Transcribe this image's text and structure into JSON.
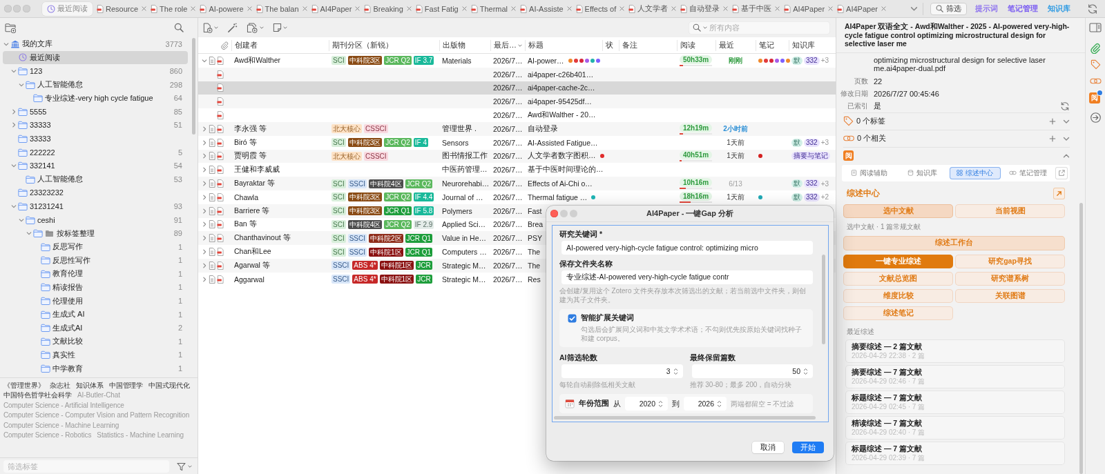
{
  "tab_bar": {
    "tabs": [
      {
        "label": "最近阅读",
        "kind": "recent",
        "selected": true
      },
      {
        "label": "Resource",
        "kind": "pdf",
        "selected": false
      },
      {
        "label": "The role",
        "kind": "pdf",
        "selected": false
      },
      {
        "label": "AI-powere",
        "kind": "pdf",
        "selected": false
      },
      {
        "label": "The balan",
        "kind": "pdf",
        "selected": false
      },
      {
        "label": "AI4Paper",
        "kind": "pdf",
        "selected": false
      },
      {
        "label": "Breaking",
        "kind": "pdf",
        "selected": false
      },
      {
        "label": "Fast Fatig",
        "kind": "pdf",
        "selected": false
      },
      {
        "label": "Thermal",
        "kind": "pdf",
        "selected": false
      },
      {
        "label": "AI-Assiste",
        "kind": "pdf",
        "selected": false
      },
      {
        "label": "Effects of",
        "kind": "pdf",
        "selected": false
      },
      {
        "label": "人文学者",
        "kind": "pdf",
        "selected": false
      },
      {
        "label": "自动登录",
        "kind": "pdf",
        "selected": false
      },
      {
        "label": "基于中医",
        "kind": "pdf",
        "selected": false
      },
      {
        "label": "AI4Paper",
        "kind": "pdf",
        "selected": false
      },
      {
        "label": "AI4Paper",
        "kind": "pdf",
        "selected": false
      }
    ],
    "actions": [
      {
        "label": "筛选",
        "kind": "search"
      },
      {
        "label": "提示词",
        "kind": "link",
        "color": "#8f74ef"
      },
      {
        "label": "笔记管理",
        "kind": "link",
        "color": "#7a5cf2"
      },
      {
        "label": "知识库",
        "kind": "link",
        "color": "#2f9be3"
      }
    ]
  },
  "sidebar": {
    "tree": [
      {
        "label": "我的文库",
        "count": "3773",
        "kind": "library",
        "expanded": true,
        "selected": false,
        "children": [
          {
            "label": "最近阅读",
            "kind": "recent",
            "selected": true
          },
          {
            "label": "123",
            "count": "860",
            "kind": "folder",
            "expanded": true,
            "selected": false,
            "children": [
              {
                "label": "人工智能倦怠",
                "count": "298",
                "kind": "folder",
                "expanded": true,
                "selected": false,
                "children": [
                  {
                    "label": "专业综述-very high cycle fatigue",
                    "count": "64",
                    "kind": "folder",
                    "selected": false
                  }
                ]
              }
            ]
          },
          {
            "label": "5555",
            "count": "85",
            "kind": "folder",
            "expanded": false,
            "selected": false
          },
          {
            "label": "33333",
            "count": "51",
            "kind": "folder",
            "expanded": false,
            "selected": false
          },
          {
            "label": "33333",
            "kind": "folder",
            "selected": false
          },
          {
            "label": "222222",
            "count": "5",
            "kind": "folder",
            "selected": false
          },
          {
            "label": "332141",
            "count": "54",
            "kind": "folder",
            "expanded": true,
            "selected": false,
            "children": [
              {
                "label": "人工智能倦怠",
                "count": "53",
                "kind": "folder",
                "selected": false
              }
            ]
          },
          {
            "label": "23323232",
            "kind": "folder",
            "selected": false
          },
          {
            "label": "31231241",
            "count": "93",
            "kind": "folder",
            "expanded": true,
            "selected": false,
            "children": [
              {
                "label": "ceshi",
                "count": "91",
                "kind": "folder",
                "expanded": true,
                "selected": false,
                "children": [
                  {
                    "label": "按标签整理",
                    "count": "89",
                    "kind": "tag_group",
                    "expanded": true,
                    "selected": false,
                    "children": [
                      {
                        "label": "反思写作",
                        "count": "1",
                        "kind": "folder",
                        "selected": false
                      },
                      {
                        "label": "反思性写作",
                        "count": "1",
                        "kind": "folder",
                        "selected": false
                      },
                      {
                        "label": "教育伦理",
                        "count": "1",
                        "kind": "folder",
                        "selected": false
                      },
                      {
                        "label": "精读报告",
                        "count": "1",
                        "kind": "folder",
                        "selected": false
                      },
                      {
                        "label": "伦理使用",
                        "count": "1",
                        "kind": "folder",
                        "selected": false
                      },
                      {
                        "label": "生成式 AI",
                        "count": "1",
                        "kind": "folder",
                        "selected": false
                      },
                      {
                        "label": "生成式AI",
                        "count": "2",
                        "kind": "folder",
                        "selected": false
                      },
                      {
                        "label": "文献比较",
                        "count": "1",
                        "kind": "folder",
                        "selected": false
                      },
                      {
                        "label": "真实性",
                        "count": "1",
                        "kind": "folder",
                        "selected": false
                      },
                      {
                        "label": "中学教育",
                        "count": "1",
                        "kind": "folder",
                        "selected": false
                      }
                    ]
                  }
                ]
              }
            ]
          }
        ]
      }
    ],
    "tags": [
      {
        "label": "《管理世界》",
        "dimmed": false
      },
      {
        "label": "杂志社",
        "dimmed": false
      },
      {
        "label": "知识体系",
        "dimmed": false
      },
      {
        "label": "中国管理学",
        "dimmed": false
      },
      {
        "label": "中国式现代化",
        "dimmed": false
      },
      {
        "label": "中国特色哲学社会科学",
        "dimmed": false
      },
      {
        "label": "AI-Butler-Chat",
        "dimmed": true
      },
      {
        "label": "Computer Science - Artificial Intelligence",
        "dimmed": true
      },
      {
        "label": "Computer Science - Computer Vision and Pattern Recognition",
        "dimmed": true
      },
      {
        "label": "Computer Science - Machine Learning",
        "dimmed": true
      },
      {
        "label": "Computer Science - Robotics",
        "dimmed": true
      },
      {
        "label": "Statistics - Machine Learning",
        "dimmed": true
      }
    ],
    "tag_filter": {
      "placeholder": "筛选标签"
    }
  },
  "items_toolbar": {
    "search": {
      "placeholder": "所有内容"
    }
  },
  "table": {
    "columns": [
      {
        "label": "创建者",
        "sorted": false
      },
      {
        "label": "期刊分区（新锐）",
        "sorted": false
      },
      {
        "label": "出版物",
        "sorted": false
      },
      {
        "label": "最后…",
        "sorted": true
      },
      {
        "label": "标题",
        "sorted": false
      },
      {
        "label": "状",
        "sorted": false
      },
      {
        "label": "备注",
        "sorted": false
      },
      {
        "label": "阅读",
        "sorted": false
      },
      {
        "label": "最近",
        "sorted": false
      },
      {
        "label": "笔记",
        "sorted": false
      },
      {
        "label": "知识库",
        "sorted": false
      }
    ],
    "rows": [
      {
        "kind": "item",
        "expanded": true,
        "selected": false,
        "creator": "Awd和Walther",
        "badges": [
          {
            "label": "SCI",
            "kind": "soft",
            "color": "#d8efdb"
          },
          {
            "label": "中科院3区",
            "kind": "solid",
            "color": "#8a4b14"
          },
          {
            "label": "JCR Q2",
            "kind": "solid",
            "color": "#5bb85d"
          },
          {
            "label": "IF 3.7",
            "kind": "solid",
            "color": "#19b99a"
          }
        ],
        "publication": "Materials",
        "date": "2026/7…",
        "title": "AI-power…",
        "title_dots": [
          {
            "color": "#f0892b"
          },
          {
            "color": "#e23b3b"
          },
          {
            "color": "#d7263d"
          },
          {
            "color": "#a55eea"
          },
          {
            "color": "#20b2aa"
          },
          {
            "color": "#7d5fff"
          }
        ],
        "reading": {
          "time": "50h33m",
          "level": 0.1
        },
        "recent": {
          "text": "刚刚",
          "kind": "now"
        },
        "note_dots": [
          {
            "color": "#f0892b"
          },
          {
            "color": "#e23b3b"
          },
          {
            "color": "#d7263d"
          },
          {
            "color": "#a55eea"
          },
          {
            "color": "#7d5fff"
          },
          {
            "color": "#f0892b"
          }
        ],
        "kb": [
          {
            "label": "默",
            "color": "#d2f0e8"
          },
          {
            "label": "332",
            "color": "#e8e2fd"
          }
        ],
        "kb_more": "+3"
      },
      {
        "kind": "attachment",
        "selected": false,
        "date": "2026/7…",
        "title": "ai4paper-c26b401…"
      },
      {
        "kind": "attachment",
        "selected": true,
        "date": "2026/7…",
        "title": "ai4paper-cache-2c…"
      },
      {
        "kind": "attachment",
        "selected": false,
        "date": "2026/7…",
        "title": "ai4paper-95425df…"
      },
      {
        "kind": "attachment",
        "selected": false,
        "date": "2026/7…",
        "title": "Awd和Walther - 20…"
      },
      {
        "kind": "item",
        "expanded": false,
        "selected": false,
        "creator": "李永强 等",
        "badges": [
          {
            "label": "北大核心",
            "kind": "soft",
            "color": "#fde2c6"
          },
          {
            "label": "CSSCI",
            "kind": "soft",
            "color": "#f9d9df"
          }
        ],
        "publication": "管理世界 .",
        "date": "2026/7…",
        "title": "自动登录",
        "reading": {
          "time": "12h19m",
          "level": 0.1
        },
        "recent": {
          "text": "2小时前",
          "kind": "hours"
        }
      },
      {
        "kind": "item",
        "expanded": false,
        "selected": false,
        "creator": "Biró 等",
        "badges": [
          {
            "label": "SCI",
            "kind": "soft",
            "color": "#d8efdb"
          },
          {
            "label": "中科院3区",
            "kind": "solid",
            "color": "#8a4b14"
          },
          {
            "label": "JCR Q2",
            "kind": "solid",
            "color": "#5bb85d"
          },
          {
            "label": "IF 4",
            "kind": "solid",
            "color": "#19b99a"
          }
        ],
        "publication": "Sensors",
        "date": "2026/7…",
        "title": "AI-Assisted Fatigue…",
        "recent": {
          "text": "1天前",
          "kind": "days"
        },
        "kb": [
          {
            "label": "默",
            "color": "#d2f0e8"
          },
          {
            "label": "332",
            "color": "#e8e2fd"
          }
        ],
        "kb_more": "+3"
      },
      {
        "kind": "item",
        "expanded": false,
        "selected": false,
        "creator": "贾明霞 等",
        "badges": [
          {
            "label": "北大核心",
            "kind": "soft",
            "color": "#fde2c6"
          },
          {
            "label": "CSSCI",
            "kind": "soft",
            "color": "#f9d9df"
          }
        ],
        "publication": "图书情报工作",
        "date": "2026/7…",
        "title": "人文学者数字图积…",
        "title_dots": [
          {
            "color": "#e02b2b"
          }
        ],
        "reading": {
          "time": "40h51m",
          "level": 0.06
        },
        "recent": {
          "text": "1天前",
          "kind": "days"
        },
        "note_dots": [
          {
            "color": "#d42020"
          }
        ],
        "kb": [
          {
            "label": "摘要与笔记",
            "color": "#e8e2fd"
          }
        ]
      },
      {
        "kind": "item",
        "expanded": false,
        "selected": false,
        "creator": "王健和李威威",
        "publication": "中医药管理…",
        "date": "2026/7…",
        "title": "基于中医时间理论的…"
      },
      {
        "kind": "item",
        "expanded": false,
        "selected": false,
        "creator": "Bayraktar 等",
        "badges": [
          {
            "label": "SCI",
            "kind": "soft",
            "color": "#d8efdb"
          },
          {
            "label": "SSCI",
            "kind": "soft",
            "color": "#d8e6f8"
          },
          {
            "label": "中科院4区",
            "kind": "solid",
            "color": "#4d4d4d"
          },
          {
            "label": "JCR Q2",
            "kind": "solid",
            "color": "#5bb85d"
          }
        ],
        "publication": "Neurorehabi…",
        "date": "2026/7…",
        "title": "Effects of Ai-Chi o…",
        "reading": {
          "time": "10h16m",
          "level": 0.18
        },
        "recent": {
          "text": "6/13",
          "kind": "date"
        },
        "kb": [
          {
            "label": "默",
            "color": "#d2f0e8"
          },
          {
            "label": "332",
            "color": "#e8e2fd"
          }
        ],
        "kb_more": "+3"
      },
      {
        "kind": "item",
        "expanded": false,
        "selected": false,
        "creator": "Chawla",
        "badges": [
          {
            "label": "SCI",
            "kind": "soft",
            "color": "#d8efdb"
          },
          {
            "label": "中科院3区",
            "kind": "solid",
            "color": "#8a4b14"
          },
          {
            "label": "JCR Q2",
            "kind": "solid",
            "color": "#5bb85d"
          },
          {
            "label": "IF 4.4",
            "kind": "solid",
            "color": "#19b99a"
          }
        ],
        "publication": "Journal of …",
        "date": "2026/7…",
        "title": "Thermal fatigue …",
        "title_dots": [
          {
            "color": "#1fb5b5"
          }
        ],
        "reading": {
          "time": "18h16m",
          "level": 0.33
        },
        "recent": {
          "text": "1天前",
          "kind": "days"
        },
        "note_dots": [
          {
            "color": "#1fa9b5"
          }
        ],
        "kb": [
          {
            "label": "默",
            "color": "#d2f0e8"
          },
          {
            "label": "332",
            "color": "#e8e2fd"
          }
        ],
        "kb_more": "+2"
      },
      {
        "kind": "item",
        "expanded": false,
        "selected": false,
        "creator": "Barriere 等",
        "badges": [
          {
            "label": "SCI",
            "kind": "soft",
            "color": "#d8efdb"
          },
          {
            "label": "中科院3区",
            "kind": "solid",
            "color": "#8a4b14"
          },
          {
            "label": "JCR Q1",
            "kind": "solid",
            "color": "#1e9e3c"
          },
          {
            "label": "IF 5.8",
            "kind": "solid",
            "color": "#19b99a"
          }
        ],
        "publication": "Polymers",
        "date": "2026/7…",
        "title": "Fast"
      },
      {
        "kind": "item",
        "expanded": false,
        "selected": false,
        "creator": "Ban 等",
        "badges": [
          {
            "label": "SCI",
            "kind": "soft",
            "color": "#d8efdb"
          },
          {
            "label": "中科院4区",
            "kind": "solid",
            "color": "#4d4d4d"
          },
          {
            "label": "JCR Q2",
            "kind": "solid",
            "color": "#5bb85d"
          },
          {
            "label": "IF 2.9",
            "kind": "soft",
            "color": "#e4ece9"
          }
        ],
        "publication": "Applied Sci…",
        "date": "2026/7…",
        "title": "Brea"
      },
      {
        "kind": "item",
        "expanded": false,
        "selected": false,
        "creator": "Chanthavinout 等",
        "badges": [
          {
            "label": "SCI",
            "kind": "soft",
            "color": "#d8efdb"
          },
          {
            "label": "SSCI",
            "kind": "soft",
            "color": "#d8e6f8"
          },
          {
            "label": "中科院2区",
            "kind": "solid",
            "color": "#8f2d1b"
          },
          {
            "label": "JCR Q1",
            "kind": "solid",
            "color": "#1e9e3c"
          }
        ],
        "publication": "Value in He…",
        "date": "2026/7…",
        "title": "PSY"
      },
      {
        "kind": "item",
        "expanded": false,
        "selected": false,
        "creator": "Chan和Lee",
        "badges": [
          {
            "label": "SCI",
            "kind": "soft",
            "color": "#d8efdb"
          },
          {
            "label": "SSCI",
            "kind": "soft",
            "color": "#d8e6f8"
          },
          {
            "label": "中科院1区",
            "kind": "solid",
            "color": "#8a1111"
          },
          {
            "label": "JCR Q1",
            "kind": "solid",
            "color": "#1e9e3c"
          }
        ],
        "publication": "Computers …",
        "date": "2026/7…",
        "title": "The"
      },
      {
        "kind": "item",
        "expanded": false,
        "selected": false,
        "creator": "Agarwal 等",
        "badges": [
          {
            "label": "SSCI",
            "kind": "soft",
            "color": "#d8e6f8"
          },
          {
            "label": "ABS 4*",
            "kind": "solid",
            "color": "#c62828"
          },
          {
            "label": "中科院1区",
            "kind": "solid",
            "color": "#8a1111"
          },
          {
            "label": "JCR",
            "kind": "solid",
            "color": "#1e9e3c"
          }
        ],
        "publication": "Strategic M…",
        "date": "2026/7…",
        "title": "The"
      },
      {
        "kind": "item",
        "expanded": false,
        "selected": false,
        "creator": "Aggarwal",
        "badges": [
          {
            "label": "SSCI",
            "kind": "soft",
            "color": "#d8e6f8"
          },
          {
            "label": "ABS 4*",
            "kind": "solid",
            "color": "#c62828"
          },
          {
            "label": "中科院1区",
            "kind": "solid",
            "color": "#8a1111"
          },
          {
            "label": "JCR",
            "kind": "solid",
            "color": "#1e9e3c"
          }
        ],
        "publication": "Strategic M…",
        "date": "2026/7…",
        "title": "Res"
      }
    ]
  },
  "item_pane": {
    "title": "AI4Paper 双语全文 - Awd和Walther - 2025 - AI-powered very-high-cycle fatigue control optimizing microstructural design for selective laser me",
    "file_name": "optimizing microstructural design for selective laser me.ai4paper-dual.pdf",
    "fields": [
      {
        "label": "页数",
        "value": "22"
      },
      {
        "label": "修改日期",
        "value": "2026/7/27 00:45:46"
      },
      {
        "label": "已索引",
        "value": "是",
        "kind": "reindex"
      }
    ],
    "sections": [
      {
        "label": "0 个标签",
        "kind": "tags",
        "expanded": false
      },
      {
        "label": "0 个相关",
        "kind": "related",
        "expanded": false
      }
    ],
    "plugin": {
      "badge": "阅",
      "expanded": true,
      "tabs": [
        {
          "label": "阅读辅助",
          "kind": "reading",
          "selected": false
        },
        {
          "label": "知识库",
          "kind": "knowledge",
          "selected": false
        },
        {
          "label": "综述中心",
          "kind": "review",
          "selected": true
        },
        {
          "label": "笔记管理",
          "kind": "notes",
          "selected": false
        }
      ],
      "heading": "综述中心",
      "scopes": [
        {
          "label": "选中文献",
          "selected": true
        },
        {
          "label": "当前视图",
          "selected": false
        }
      ],
      "scope_note": "选中文献 · 1 篇常规文献",
      "workbench": "综述工作台",
      "actions": [
        {
          "label": "一键专业综述",
          "kind": "primary"
        },
        {
          "label": "研究gap寻找",
          "kind": "secondary"
        },
        {
          "label": "文献总览图",
          "kind": "secondary"
        },
        {
          "label": "研究谱系树",
          "kind": "secondary"
        },
        {
          "label": "维度比较",
          "kind": "secondary"
        },
        {
          "label": "关联图谱",
          "kind": "secondary"
        },
        {
          "label": "综述笔记",
          "kind": "secondary"
        }
      ],
      "recent_label": "最近综述",
      "recent": [
        {
          "title": "摘要综述 — 2 篇文献",
          "meta": "2026-04-29 22:38 · 2 篇"
        },
        {
          "title": "摘要综述 — 7 篇文献",
          "meta": "2026-04-29 02:46 · 7 篇"
        },
        {
          "title": "标题综述 — 7 篇文献",
          "meta": "2026-04-29 02:45 · 7 篇"
        },
        {
          "title": "精读综述 — 7 篇文献",
          "meta": "2026-04-29 02:40 · 7 篇"
        },
        {
          "title": "标题综述 — 7 篇文献",
          "meta": "2026-04-29 02:39 · 7 篇"
        }
      ]
    }
  },
  "side_strip": {
    "plugin_badge": "阅"
  },
  "dialog": {
    "title": "AI4Paper - 一键Gap 分析",
    "fields": [
      {
        "label": "研究关键词 *",
        "value": "AI-powered very-high-cycle fatigue control: optimizing micro"
      },
      {
        "label": "保存文件夹名称",
        "value": "专业综述-AI-powered very-high-cycle fatigue contr",
        "hint": "会创建/复用这个 Zotero 文件夹存放本次筛选出的文献；若当前选中文件夹，则创建为其子文件夹。"
      }
    ],
    "option": {
      "label": "智能扩展关键词",
      "checked": true,
      "hint": "勾选后会扩展同义词和中英文学术术语；不勾则优先按原始关键词找种子和建 corpus。"
    },
    "numbers": [
      {
        "label": "AI筛选轮数",
        "value": "3",
        "hint": "每轮自动剔除低相关文献"
      },
      {
        "label": "最终保留篇数",
        "value": "50",
        "hint": "推荐 30-80；最多 200，自动分块"
      }
    ],
    "year_range": {
      "label": "年份范围",
      "from_label": "从",
      "from": "2020",
      "to_label": "到",
      "to": "2026",
      "hint": "两端都留空 = 不过滤"
    },
    "buttons": [
      {
        "label": "取消",
        "kind": "cancel"
      },
      {
        "label": "开始",
        "kind": "confirm"
      }
    ]
  }
}
